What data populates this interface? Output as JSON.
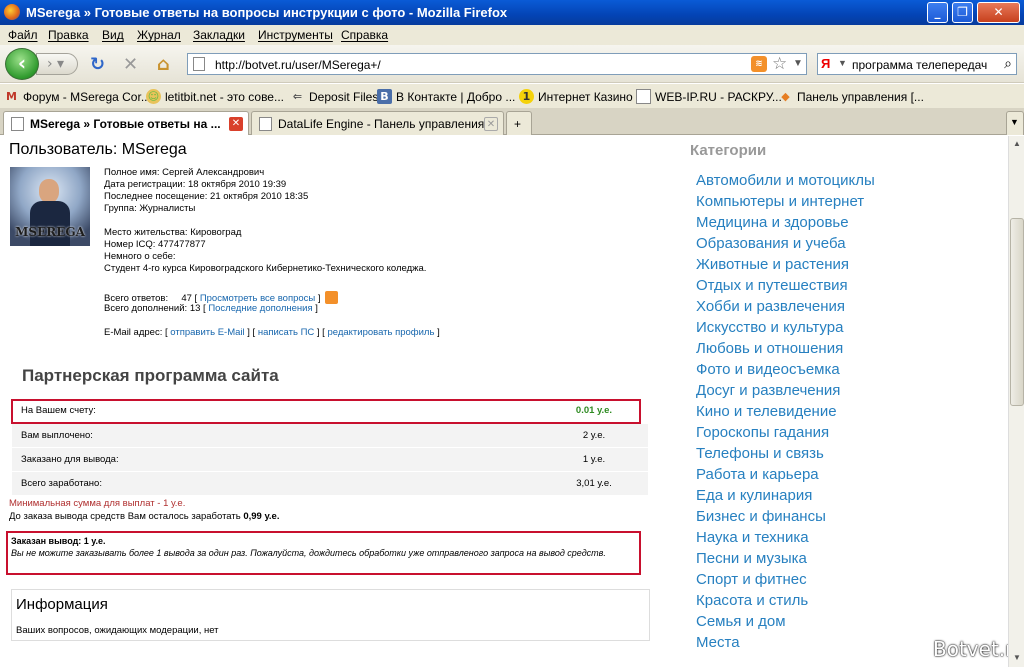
{
  "window": {
    "title": "MSerega » Готовые ответы на вопросы инструкции с фото - Mozilla Firefox"
  },
  "menu": [
    "Файл",
    "Правка",
    "Вид",
    "Журнал",
    "Закладки",
    "Инструменты",
    "Справка"
  ],
  "nav": {
    "url": "http://botvet.ru/user/MSerega+/",
    "search_query": "программа телепередач",
    "search_engine_letter": "Я"
  },
  "bookmarks": [
    {
      "label": "Форум - MSerega Cor...",
      "icon": "m-icon"
    },
    {
      "label": "letitbit.net - это сове...",
      "icon": "letitbit-icon"
    },
    {
      "label": "Deposit Files",
      "icon": "depositfiles-icon"
    },
    {
      "label": "В Контакте | Добро ...",
      "icon": "vkontakte-icon"
    },
    {
      "label": "Интернет Казино",
      "icon": "casino-icon"
    },
    {
      "label": "WEB-IP.RU - РАСКРУ...",
      "icon": "page-icon"
    },
    {
      "label": "Панель управления [...",
      "icon": "panel-icon"
    }
  ],
  "tabs": [
    {
      "label": "MSerega » Готовые ответы на ...",
      "active": true
    },
    {
      "label": "DataLife Engine - Панель управления",
      "active": false
    }
  ],
  "profile": {
    "heading": "Пользователь: MSerega",
    "avatar_caption": "MSEREGA",
    "full_name": "Полное имя: Сергей Александрович",
    "registered": "Дата регистрации: 18 октября 2010 19:39",
    "last_visit": "Последнее посещение: 21 октября 2010 18:35",
    "group": "Группа: Журналисты",
    "city": "Место жительства: Кировоград",
    "icq": "Номер ICQ: 477477877",
    "about_label": "Немного о себе:",
    "about": "Студент 4-го курса Кировоградского Кибернетико-Технического коледжа.",
    "answers_label": "Всего ответов:",
    "answers_count": "47",
    "answers_link": "Просмотреть все вопросы",
    "additions_label": "Всего дополнений:",
    "additions_count": "13",
    "additions_link": "Последние дополнения",
    "email_label": "E-Mail адрес:",
    "send_email": "отправить E-Mail",
    "write_pm": "написать ПС",
    "edit_profile": "редактировать профиль"
  },
  "partner": {
    "title": "Партнерская программа сайта",
    "rows": [
      {
        "label": "На Вашем счету:",
        "value": "0.01 у.е."
      },
      {
        "label": "Вам выплочено:",
        "value": "2 у.е."
      },
      {
        "label": "Заказано для вывода:",
        "value": "1 у.е."
      },
      {
        "label": "Всего заработано:",
        "value": "3,01 у.е."
      }
    ],
    "min_sum": "Минимальная сумма для выплат - 1 у.е.",
    "remain_text": "До заказа вывода средств Вам осталось заработать",
    "remain_value": "0,99 у.е.",
    "order_title": "Заказан вывод: 1 у.е.",
    "order_note": "Вы не можите заказывать более 1 вывода за один раз. Пожалуйста, дождитесь обработки уже отправленого запроса на вывод средств."
  },
  "info": {
    "title": "Информация",
    "text": "Ваших вопросов, ожидающих модерации, нет"
  },
  "categories": {
    "title": "Категории",
    "items": [
      "Автомобили и мотоциклы",
      "Компьютеры и интернет",
      "Медицина и здоровье",
      "Образования и учеба",
      "Животные и растения",
      "Отдых и путешествия",
      "Хобби и развлечения",
      "Искусство и культура",
      "Любовь и отношения",
      "Фото и видеосъемка",
      "Досуг и развлечения",
      "Кино и телевидение",
      "Гороскопы гадания",
      "Телефоны и связь",
      "Работа и карьера",
      "Еда и кулинария",
      "Бизнес и финансы",
      "Наука и техника",
      "Песни и музыка",
      "Спорт и фитнес",
      "Красота и стиль",
      "Семья и дом",
      "Места"
    ]
  },
  "watermark": "Botvet.ru",
  "colors": {
    "accent_link": "#2780c0",
    "highlight_box": "#c8102e",
    "balance_green": "#2e8b22"
  }
}
